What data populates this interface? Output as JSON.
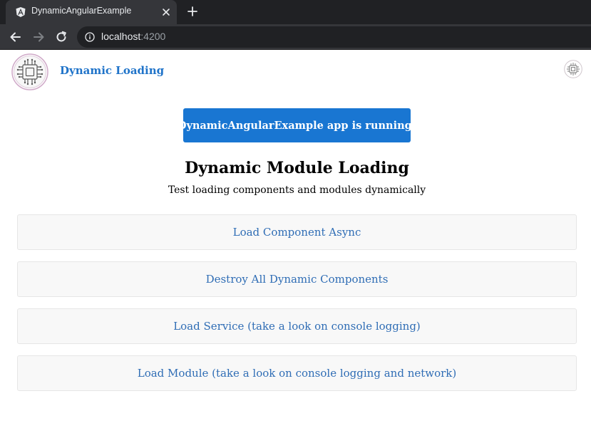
{
  "browser": {
    "tab_title": "DynamicAngularExample",
    "url_host": "localhost",
    "url_port": ":4200",
    "icons": {
      "favicon": "angular-icon",
      "close": "close-icon",
      "new_tab": "plus-icon",
      "back": "arrow-back-icon",
      "forward": "arrow-forward-icon",
      "reload": "reload-icon",
      "site_info": "info-icon"
    }
  },
  "header": {
    "logo": "chip-logo-icon",
    "app_link": "Dynamic Loading",
    "right_logo": "chip-logo-icon"
  },
  "banner": {
    "text": "DynamicAngularExample app is running!",
    "color": "#1976d2"
  },
  "main": {
    "title": "Dynamic Module Loading",
    "subtitle": "Test loading components and modules dynamically",
    "actions": [
      {
        "label": "Load Component Async"
      },
      {
        "label": "Destroy All Dynamic Components"
      },
      {
        "label": "Load Service (take a look on console logging)"
      },
      {
        "label": "Load Module (take a look on console logging and network)"
      }
    ]
  },
  "colors": {
    "link": "#1f73c9",
    "action_text": "#2f6db5",
    "chrome_dark": "#202124",
    "chrome_tab": "#35363a"
  }
}
